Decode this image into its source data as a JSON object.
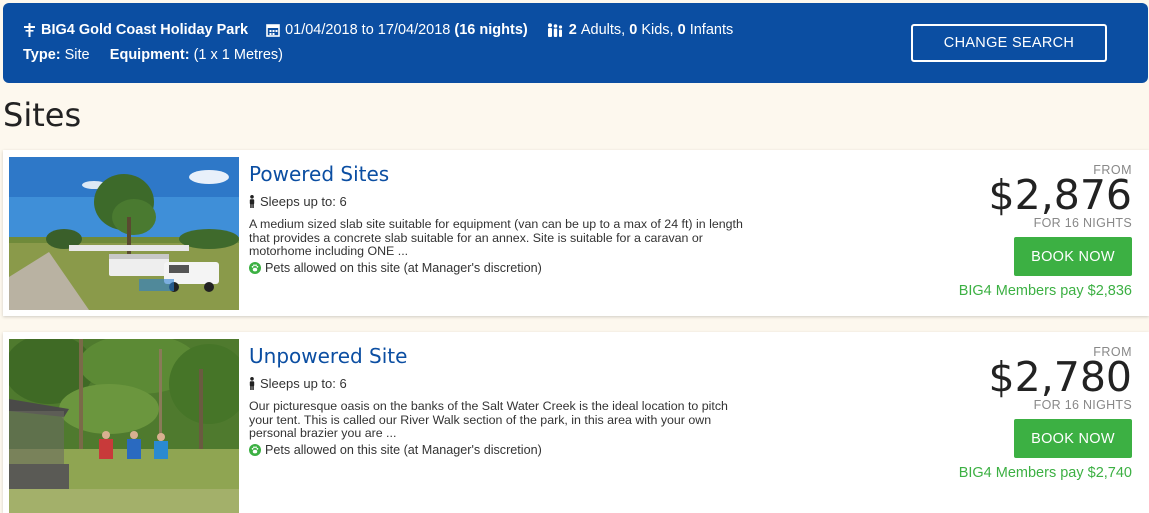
{
  "search_bar": {
    "park_name": "BIG4 Gold Coast Holiday Park",
    "date_range": "01/04/2018 to 17/04/2018",
    "nights": "(16 nights)",
    "adults_count": "2",
    "adults_label": "Adults,",
    "kids_count": "0",
    "kids_label": "Kids,",
    "infants_count": "0",
    "infants_label": "Infants",
    "type_label": "Type:",
    "type_value": "Site",
    "equipment_label": "Equipment:",
    "equipment_value": "(1 x 1 Metres)",
    "change_search_label": "CHANGE SEARCH",
    "icons": [
      "park-icon",
      "calendar-icon",
      "people-icon"
    ]
  },
  "page_title": "Sites",
  "sites": [
    {
      "name": "Powered Sites",
      "sleeps": "Sleeps up to: 6",
      "description": "A medium sized slab site suitable for equipment (van can be up to a max of 24 ft) in length that provides a concrete slab suitable for an annex. Site is suitable for a caravan or motorhome including ONE ...",
      "pets": "Pets allowed on this site (at Manager's discretion)",
      "from_label": "FROM",
      "price": "$2,876",
      "nights_label": "FOR 16 NIGHTS",
      "book_label": "BOOK NOW",
      "members_price": "BIG4 Members pay $2,836"
    },
    {
      "name": "Unpowered Site",
      "sleeps": "Sleeps up to: 6",
      "description": "Our picturesque oasis on the banks of the Salt Water Creek is the ideal location to pitch your tent. This is called our River Walk section of the park, in this area with your own personal brazier you are ...",
      "pets": "Pets allowed on this site (at Manager's discretion)",
      "from_label": "FROM",
      "price": "$2,780",
      "nights_label": "FOR 16 NIGHTS",
      "book_label": "BOOK NOW",
      "members_price": "BIG4 Members pay $2,740"
    }
  ],
  "colors": {
    "header_blue": "#0b4ea2",
    "accent_green": "#3cb043",
    "page_background": "#fdf8ee"
  }
}
